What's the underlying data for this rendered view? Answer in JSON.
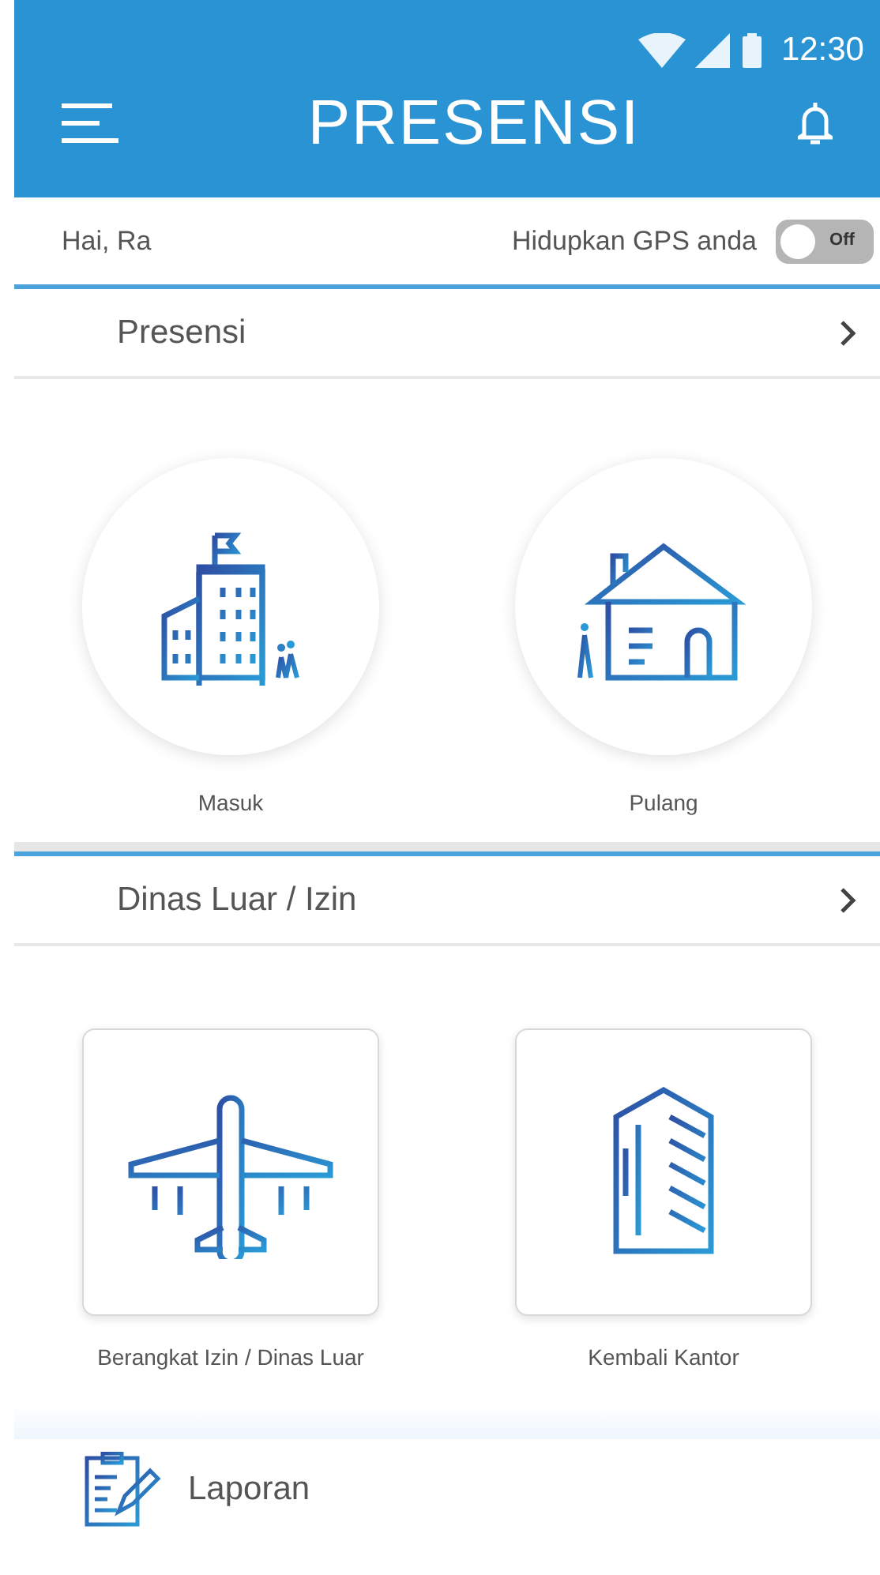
{
  "status_bar": {
    "time": "12:30"
  },
  "app_bar": {
    "title": "PRESENSI"
  },
  "greeting": "Hai, Ra",
  "gps": {
    "label": "Hidupkan GPS anda",
    "on": false,
    "toggle_label": "Off"
  },
  "sections": [
    {
      "title": "Presensi",
      "kind": "circle",
      "items": [
        {
          "label": "Masuk"
        },
        {
          "label": "Pulang"
        }
      ]
    },
    {
      "title": "Dinas Luar / Izin",
      "kind": "card",
      "items": [
        {
          "label": "Berangkat Izin / Dinas Luar"
        },
        {
          "label": "Kembali Kantor"
        }
      ]
    }
  ],
  "report": {
    "label": "Laporan"
  }
}
